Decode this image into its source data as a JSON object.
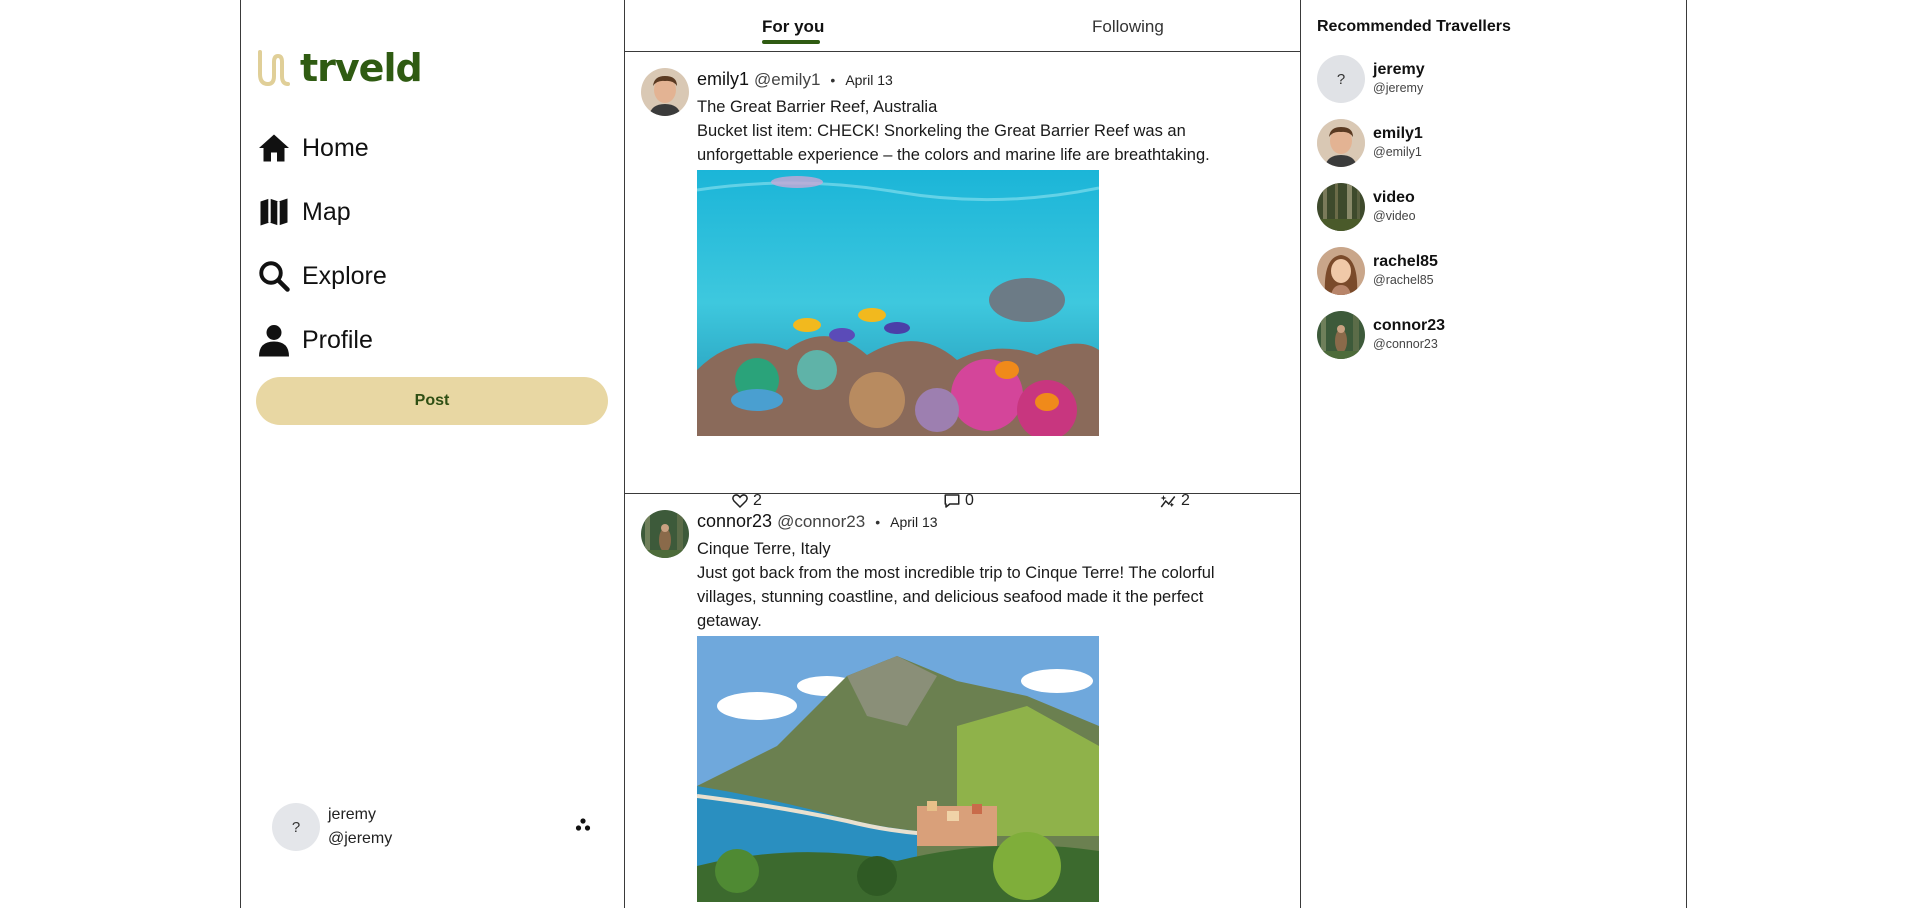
{
  "app": {
    "logo_text": "trveld",
    "brand_color": "#2f5b12",
    "accent_color": "#e8d7a3"
  },
  "nav": [
    {
      "label": "Home",
      "icon": "home-icon"
    },
    {
      "label": "Map",
      "icon": "map-icon"
    },
    {
      "label": "Explore",
      "icon": "search-icon"
    },
    {
      "label": "Profile",
      "icon": "user-icon"
    }
  ],
  "post_button_label": "Post",
  "current_user": {
    "avatar_text": "?",
    "name": "jeremy",
    "handle": "@jeremy"
  },
  "tabs": {
    "for_you": "For you",
    "following": "Following"
  },
  "posts": [
    {
      "name": "emily1",
      "handle": "@emily1",
      "dot": "•",
      "date": "April 13",
      "location": "The Great Barrier Reef, Australia",
      "text": "Bucket list item: CHECK! Snorkeling the Great Barrier Reef was an unforgettable experience – the colors and marine life are breathtaking.",
      "likes": "2",
      "comments": "0",
      "shares": "2"
    },
    {
      "name": "connor23",
      "handle": "@connor23",
      "dot": "•",
      "date": "April 13",
      "location": "Cinque Terre, Italy",
      "text": "Just got back from the most incredible trip to Cinque Terre! The colorful villages, stunning coastline, and delicious seafood made it the perfect getaway."
    }
  ],
  "recommended": {
    "title": "Recommended Travellers",
    "users": [
      {
        "name": "jeremy",
        "handle": "@jeremy",
        "avatar_text": "?"
      },
      {
        "name": "emily1",
        "handle": "@emily1"
      },
      {
        "name": "video",
        "handle": "@video"
      },
      {
        "name": "rachel85",
        "handle": "@rachel85"
      },
      {
        "name": "connor23",
        "handle": "@connor23"
      }
    ]
  }
}
